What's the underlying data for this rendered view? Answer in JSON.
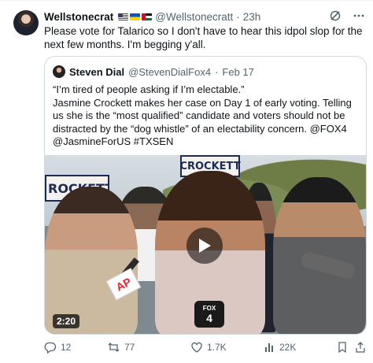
{
  "tweet": {
    "author_name": "Wellstonecrat",
    "flags": [
      "us-flag-icon",
      "ukraine-flag-icon",
      "palestine-flag-icon"
    ],
    "handle": "@Wellstonecratt",
    "separator": "·",
    "time": "23h",
    "text": "Please vote for Talarico so I don't have to hear this idpol slop for the next few months. I'm begging y'all."
  },
  "quote": {
    "author_name": "Steven Dial",
    "handle": "@StevenDialFox4",
    "separator": "·",
    "date": "Feb 17",
    "line1": "“I’m tired of people asking if I’m electable.”",
    "line2": "Jasmine Crockett makes her case on Day 1 of early voting. Telling us she is the “most qualified” candidate and voters should not be distracted by the “dog whistle” of an electability concern. @FOX4 @JasmineForUS #TXSEN",
    "video": {
      "duration": "2:20",
      "sign_left": "ROCKETT",
      "sign_center": "CROCKETT",
      "mic_left_label": "AP",
      "mic_center_label_top": "FOX",
      "mic_center_label_num": "4"
    }
  },
  "actions": {
    "replies": "12",
    "reposts": "77",
    "likes": "1.7K",
    "views": "22K"
  },
  "icons": {
    "top_right": [
      "grok-icon",
      "more-icon"
    ],
    "actions": [
      "reply-icon",
      "repost-icon",
      "like-icon",
      "views-icon",
      "bookmark-icon",
      "share-icon"
    ]
  }
}
